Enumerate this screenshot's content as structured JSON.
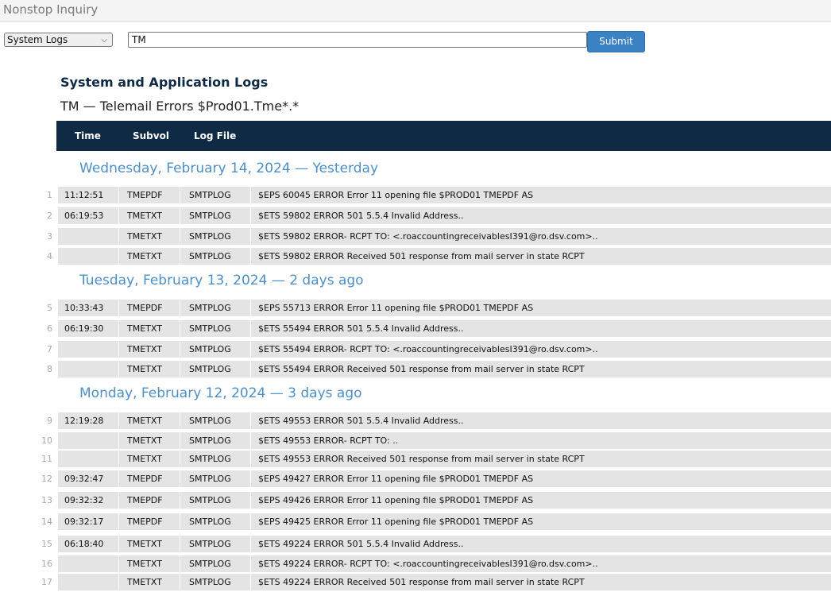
{
  "app": {
    "title": "Nonstop Inquiry"
  },
  "query": {
    "select_value": "System Logs",
    "input_value": "TM",
    "submit_label": "Submit"
  },
  "report": {
    "title": "System and Application Logs",
    "subtitle": "TM — Telemail Errors $Prod01.Tme*.*"
  },
  "columns": {
    "time": "Time",
    "subvol": "Subvol",
    "logfile": "Log File"
  },
  "groups": [
    {
      "heading": "Wednesday, February 14, 2024 — Yesterday",
      "rows": [
        {
          "n": "1",
          "time": "11:12:51",
          "subvol": "TMEPDF",
          "logfile": "SMTPLOG",
          "message": "$EPS 60045 ERROR Error 11 opening file $PROD01 TMEPDF AS"
        },
        {
          "n": "2",
          "time": "06:19:53",
          "subvol": "TMETXT",
          "logfile": "SMTPLOG",
          "message": "$ETS 59802 ERROR 501 5.5.4 Invalid Address.."
        },
        {
          "n": "3",
          "time": "",
          "subvol": "TMETXT",
          "logfile": "SMTPLOG",
          "message": "$ETS 59802 ERROR- RCPT TO: <.roaccountingreceivablesI391@ro.dsv.com>.."
        },
        {
          "n": "4",
          "time": "",
          "subvol": "TMETXT",
          "logfile": "SMTPLOG",
          "message": "$ETS 59802 ERROR Received 501 response from mail server in state RCPT"
        }
      ]
    },
    {
      "heading": "Tuesday, February 13, 2024 —  2 days ago",
      "rows": [
        {
          "n": "5",
          "time": "10:33:43",
          "subvol": "TMEPDF",
          "logfile": "SMTPLOG",
          "message": "$EPS 55713 ERROR Error 11 opening file $PROD01 TMEPDF AS"
        },
        {
          "n": "6",
          "time": "06:19:30",
          "subvol": "TMETXT",
          "logfile": "SMTPLOG",
          "message": "$ETS 55494 ERROR 501 5.5.4 Invalid Address.."
        },
        {
          "n": "7",
          "time": "",
          "subvol": "TMETXT",
          "logfile": "SMTPLOG",
          "message": "$ETS 55494 ERROR- RCPT TO: <.roaccountingreceivablesI391@ro.dsv.com>.."
        },
        {
          "n": "8",
          "time": "",
          "subvol": "TMETXT",
          "logfile": "SMTPLOG",
          "message": "$ETS 55494 ERROR Received 501 response from mail server in state RCPT"
        }
      ]
    },
    {
      "heading": "Monday, February 12, 2024 —  3 days ago",
      "rows": [
        {
          "n": "9",
          "time": "12:19:28",
          "subvol": "TMETXT",
          "logfile": "SMTPLOG",
          "message": "$ETS 49553 ERROR 501 5.5.4 Invalid Address.."
        },
        {
          "n": "10",
          "time": "",
          "subvol": "TMETXT",
          "logfile": "SMTPLOG",
          "message": "$ETS 49553 ERROR- RCPT TO: .."
        },
        {
          "n": "11",
          "time": "",
          "subvol": "TMETXT",
          "logfile": "SMTPLOG",
          "message": "$ETS 49553 ERROR Received 501 response from mail server in state RCPT"
        },
        {
          "n": "12",
          "time": "09:32:47",
          "subvol": "TMEPDF",
          "logfile": "SMTPLOG",
          "message": "$EPS 49427 ERROR Error 11 opening file $PROD01 TMEPDF AS"
        },
        {
          "n": "13",
          "time": "09:32:32",
          "subvol": "TMEPDF",
          "logfile": "SMTPLOG",
          "message": "$EPS 49426 ERROR Error 11 opening file $PROD01 TMEPDF AS"
        },
        {
          "n": "14",
          "time": "09:32:17",
          "subvol": "TMEPDF",
          "logfile": "SMTPLOG",
          "message": "$EPS 49425 ERROR Error 11 opening file $PROD01 TMEPDF AS"
        },
        {
          "n": "15",
          "time": "06:18:40",
          "subvol": "TMETXT",
          "logfile": "SMTPLOG",
          "message": "$ETS 49224 ERROR 501 5.5.4 Invalid Address.."
        },
        {
          "n": "16",
          "time": "",
          "subvol": "TMETXT",
          "logfile": "SMTPLOG",
          "message": "$ETS 49224 ERROR- RCPT TO: <.roaccountingreceivablesI391@ro.dsv.com>.."
        },
        {
          "n": "17",
          "time": "",
          "subvol": "TMETXT",
          "logfile": "SMTPLOG",
          "message": "$ETS 49224 ERROR Received 501 response from mail server in state RCPT"
        }
      ]
    }
  ]
}
